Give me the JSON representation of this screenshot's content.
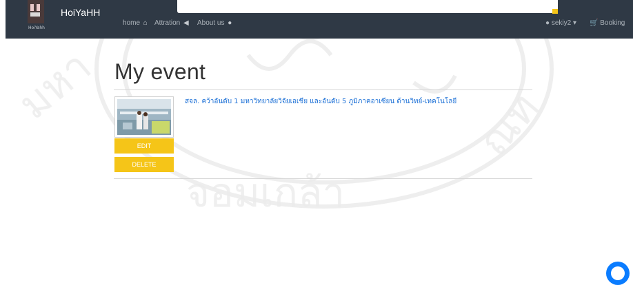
{
  "brand": {
    "name": "HoiYaHH",
    "sub": "HoiYahh"
  },
  "nav": {
    "home": "home",
    "attraction": "Attration",
    "about": "About us",
    "user": "sekiy2",
    "booking": "Booking"
  },
  "page": {
    "title": "My event"
  },
  "events": [
    {
      "title": "สจล. คว้าอันดับ 1 มหาวิทยาลัยวิจัยเอเชีย และอันดับ 5 ภูมิภาคอาเซียน ด้านวิทย์-เทคโนโลยี",
      "edit_label": "EDIT",
      "delete_label": "DELETE"
    }
  ],
  "colors": {
    "navbar": "#2f3945",
    "accent": "#f5c518",
    "link": "#1a6fd6"
  }
}
